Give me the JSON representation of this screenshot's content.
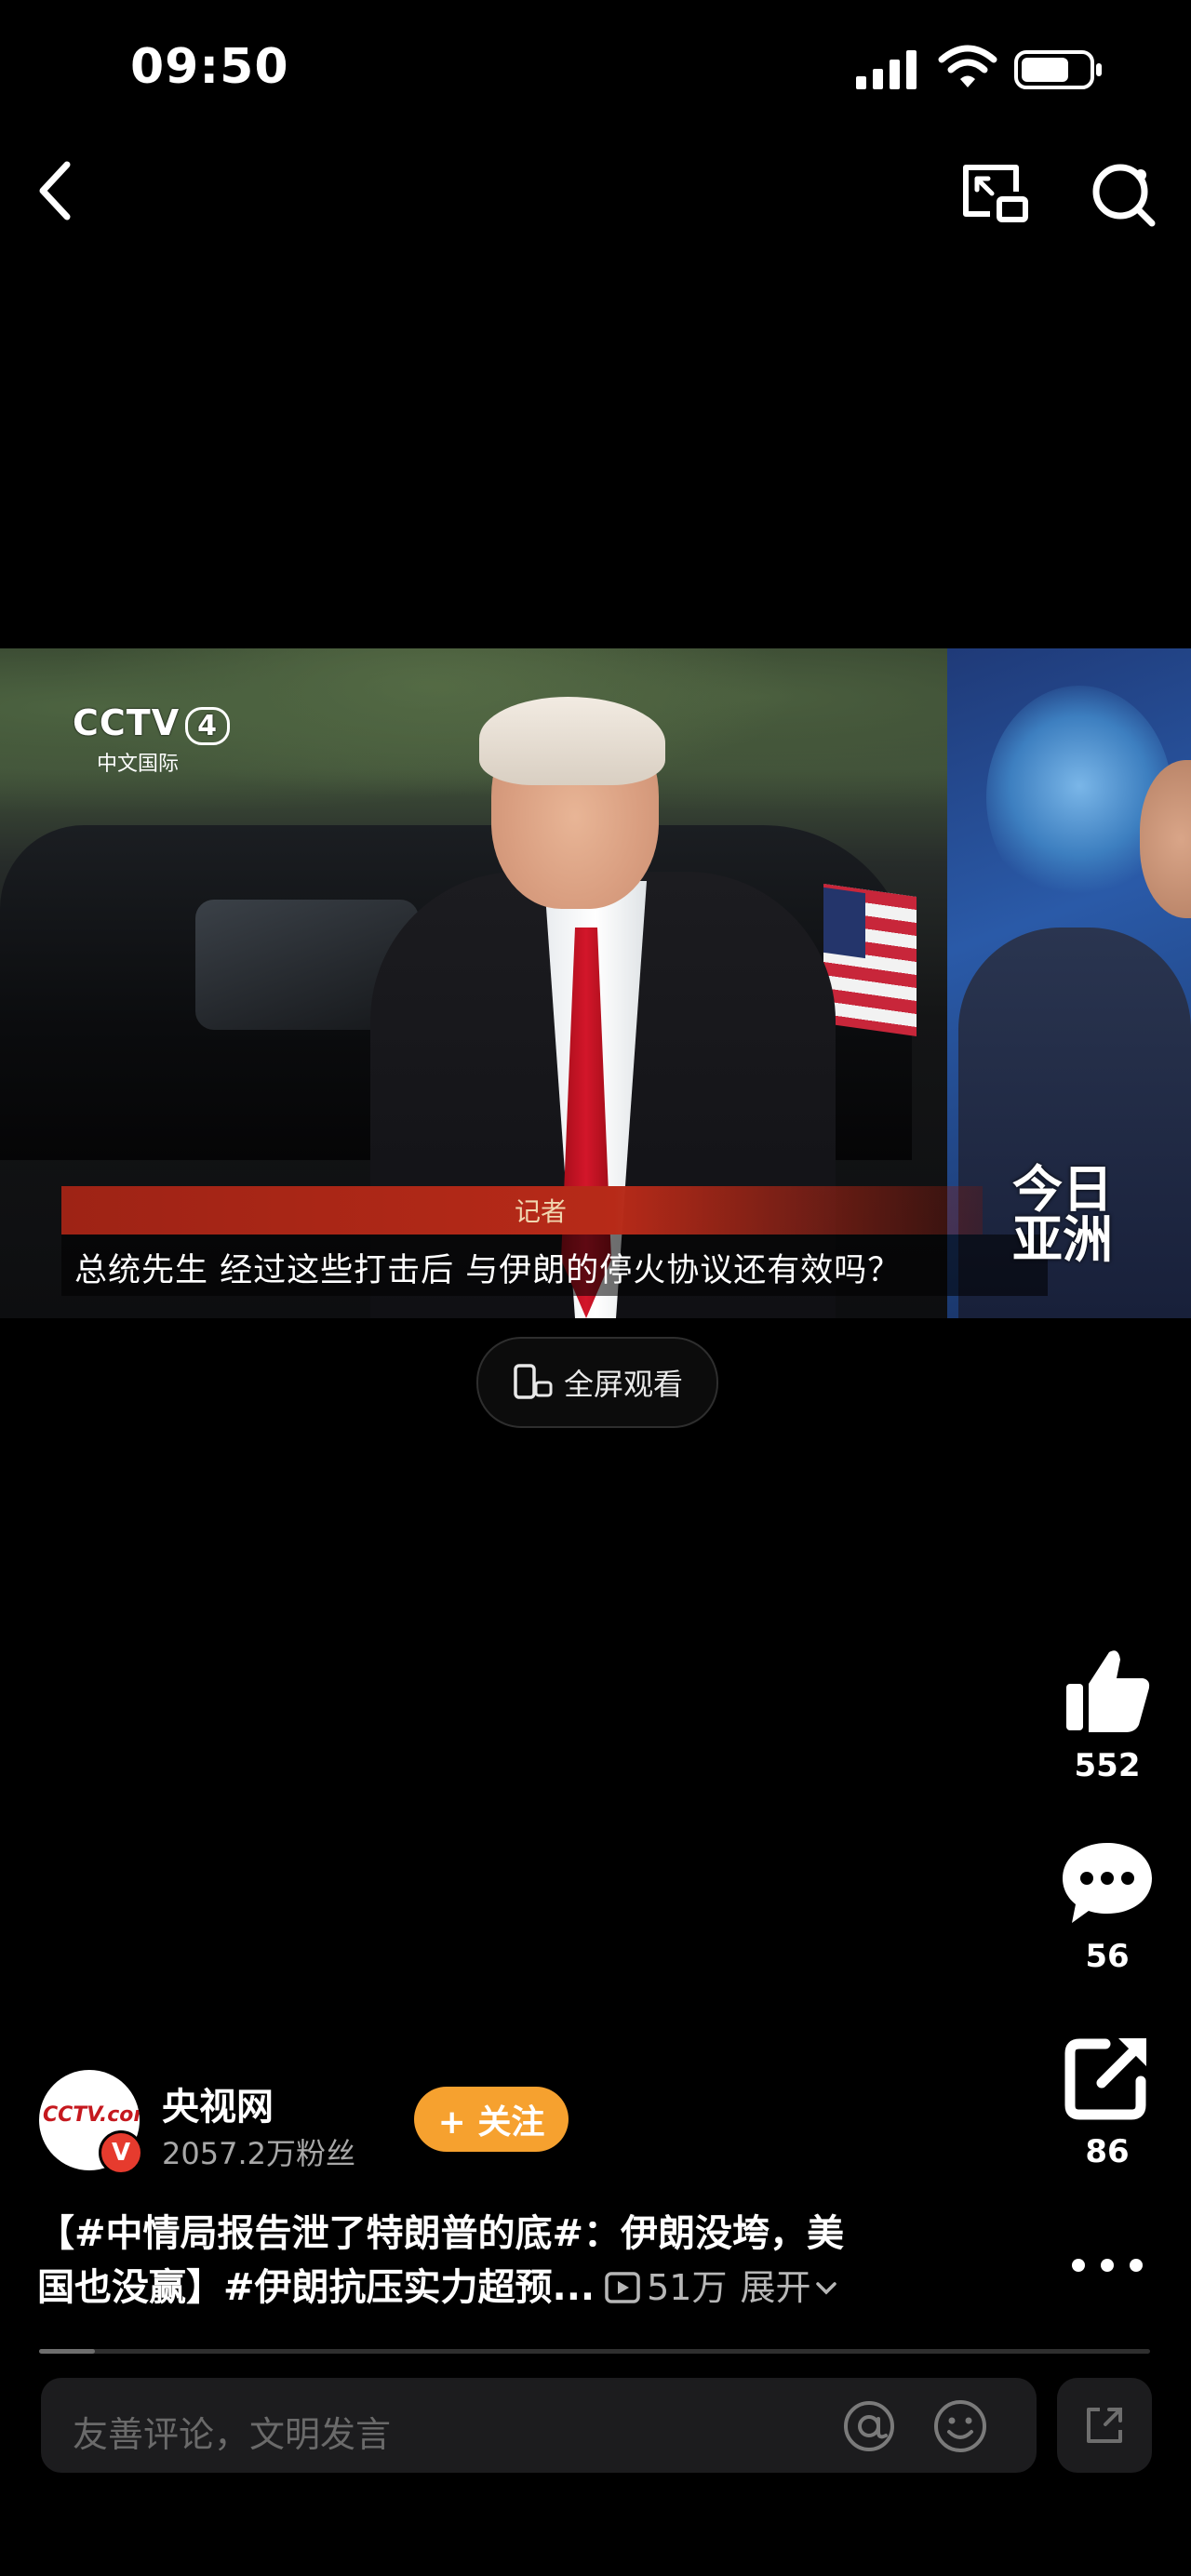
{
  "status_bar": {
    "time": "09:50"
  },
  "video": {
    "channel_logo": "CCTV 4",
    "channel_logo_mark": "CCTV",
    "channel_logo_number": "4",
    "channel_sub": "中文国际",
    "caption_speaker": "记者",
    "caption_text": "总统先生 经过这些打击后 与伊朗的停火协议还有效吗？",
    "program_logo_line1": "今日",
    "program_logo_line2": "亚洲"
  },
  "fullscreen": {
    "label": "全屏观看"
  },
  "actions": {
    "like_count": "552",
    "comment_count": "56",
    "share_count": "86"
  },
  "author": {
    "name": "央视网",
    "followers": "2057.2万粉丝",
    "avatar_text": "CCTV.com",
    "verified_mark": "V",
    "follow_label": "+ 关注"
  },
  "description": {
    "line1": "【#中情局报告泄了特朗普的底#：伊朗没垮，美",
    "line2": "国也没赢】#伊朗抗压实力超预...",
    "views": "51万",
    "expand_label": "展开"
  },
  "progress": {
    "played_fraction": 0.05
  },
  "comment_bar": {
    "placeholder": "友善评论，文明发言"
  },
  "colors": {
    "follow": "#f6a12f",
    "caption_bar": "#b72a18",
    "background": "#000000"
  }
}
